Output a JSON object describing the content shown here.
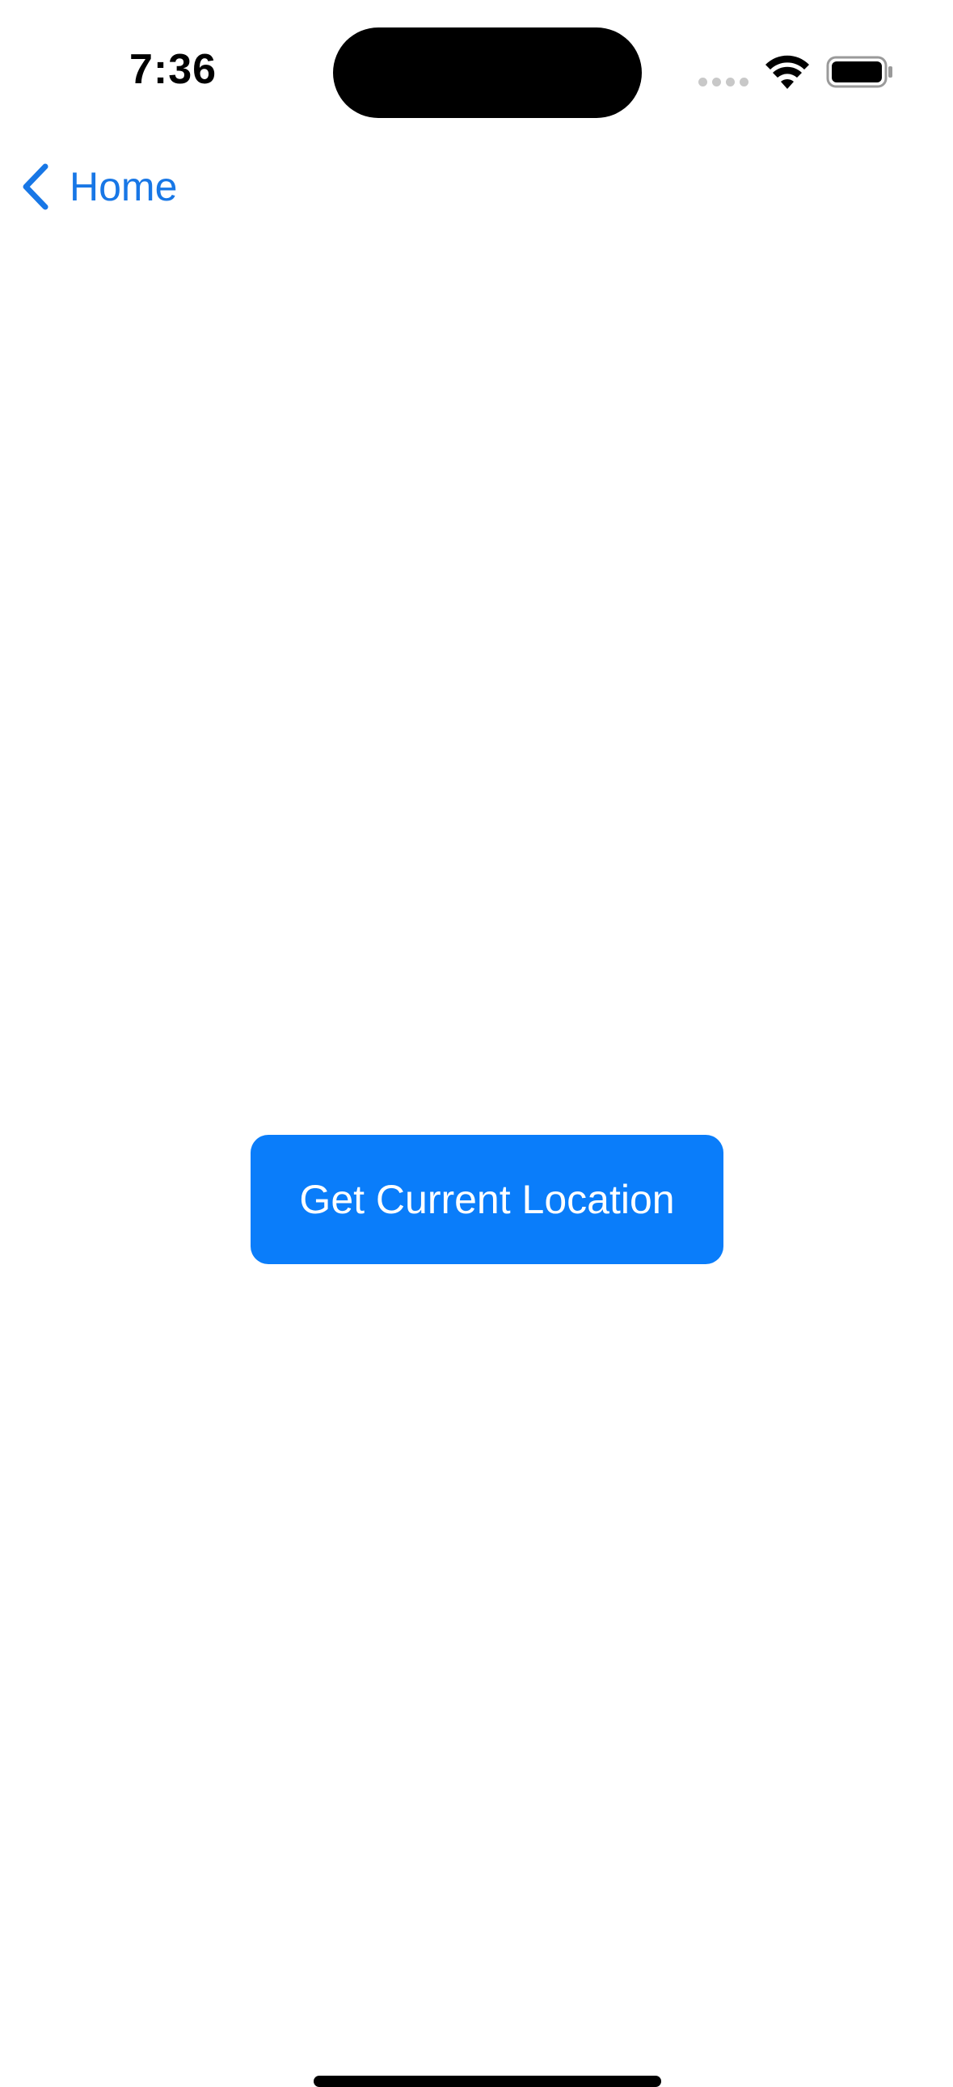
{
  "status_bar": {
    "time": "7:36",
    "icons": [
      "cellular-dots-icon",
      "wifi-icon",
      "battery-icon"
    ]
  },
  "nav": {
    "back_label": "Home",
    "back_icon": "chevron-left-icon"
  },
  "main": {
    "location_button_label": "Get Current Location"
  },
  "colors": {
    "accent": "#1877E6",
    "button_background": "#0A7DFA",
    "background": "#FFFFFF"
  }
}
